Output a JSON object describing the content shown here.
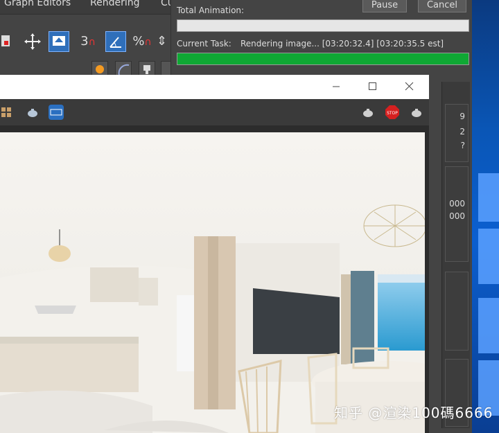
{
  "menu": {
    "items": [
      "Graph Editors",
      "Rendering",
      "Cu"
    ]
  },
  "toolbar": {
    "snap_value": "3",
    "percent_snap": "%"
  },
  "progress": {
    "pause_label": "Pause",
    "cancel_label": "Cancel",
    "total_animation_label": "Total Animation:",
    "total_animation_fraction": 0.0,
    "current_task_label": "Current Task:",
    "current_task_text": "Rendering image... [03:20:32.4] [03:20:35.5 est]",
    "current_task_fraction": 1.0,
    "side_values": [
      "9",
      "2",
      "?",
      "000",
      "000"
    ]
  },
  "framebuffer": {
    "window_buttons": [
      "minimize",
      "maximize",
      "close"
    ],
    "toolbar_left_icons": [
      "channel-icon",
      "teapot-icon",
      "film-icon"
    ],
    "toolbar_right_icons": [
      "teapot-render-icon",
      "stop-icon",
      "teapot-icon"
    ],
    "stop_label": "STOP"
  },
  "watermark": "知乎 @渲染100碼6666",
  "colors": {
    "progress_green": "#0fa834",
    "accent_blue": "#2f6fba"
  }
}
